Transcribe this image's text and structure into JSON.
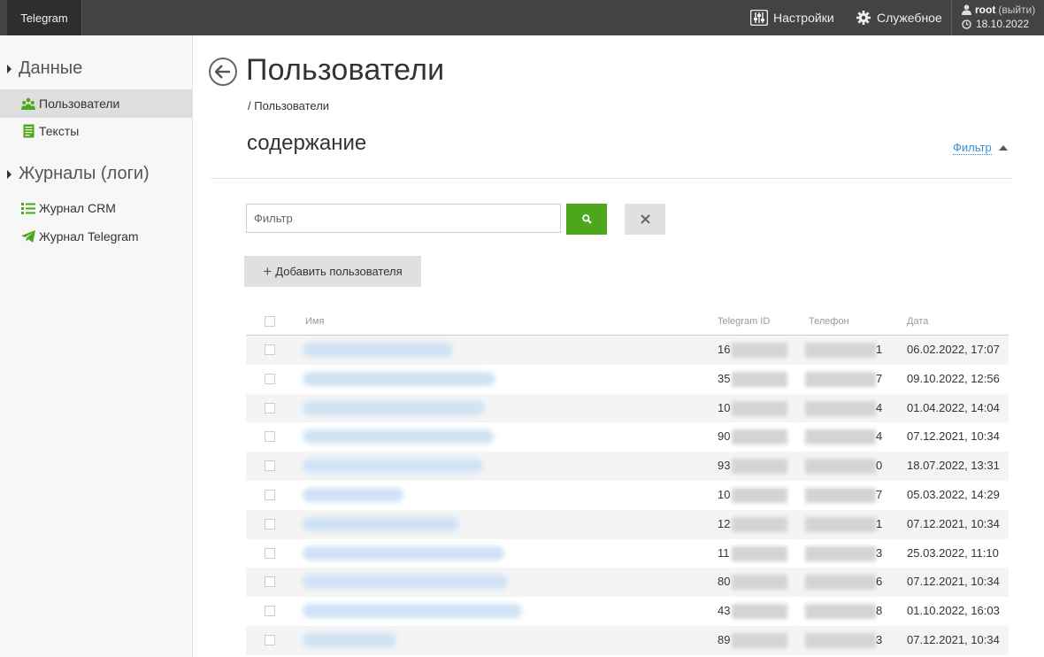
{
  "app": {
    "brand": "Telegram"
  },
  "topnav": {
    "settings": "Настройки",
    "service": "Служебное",
    "user": "root",
    "logout": "(выйти)",
    "date": "18.10.2022"
  },
  "sidebar": {
    "sections": [
      {
        "title": "Данные"
      },
      {
        "title": "Журналы (логи)"
      }
    ],
    "items": [
      {
        "label": "Пользователи",
        "icon": "users-icon",
        "active": true
      },
      {
        "label": "Тексты",
        "icon": "document-icon"
      },
      {
        "label": "Журнал CRM",
        "icon": "list-icon"
      },
      {
        "label": "Журнал Telegram",
        "icon": "telegram-icon"
      }
    ]
  },
  "page": {
    "title": "Пользователи",
    "breadcrumb": "/ Пользователи",
    "section": "содержание",
    "filter_toggle": "Фильтр"
  },
  "filter": {
    "placeholder": "Фильтр"
  },
  "actions": {
    "add_user": "Добавить пользователя"
  },
  "table": {
    "columns": {
      "name": "Имя",
      "telegram_id": "Telegram ID",
      "phone": "Телефон",
      "date": "Дата"
    },
    "rows": [
      {
        "tid": "16",
        "phone": "1",
        "date": "06.02.2022, 17:07"
      },
      {
        "tid": "35",
        "phone": "7",
        "date": "09.10.2022, 12:56"
      },
      {
        "tid": "10",
        "phone": "4",
        "date": "01.04.2022, 14:04"
      },
      {
        "tid": "90",
        "phone": "4",
        "date": "07.12.2021, 10:34"
      },
      {
        "tid": "93",
        "phone": "0",
        "date": "18.07.2022, 13:31"
      },
      {
        "tid": "10",
        "phone": "7",
        "date": "05.03.2022, 14:29"
      },
      {
        "tid": "12",
        "phone": "1",
        "date": "07.12.2021, 10:34"
      },
      {
        "tid": "11",
        "phone": "3",
        "date": "25.03.2022, 11:10"
      },
      {
        "tid": "80",
        "phone": "6",
        "date": "07.12.2021, 10:34"
      },
      {
        "tid": "43",
        "phone": "8",
        "date": "01.10.2022, 16:03"
      },
      {
        "tid": "89",
        "phone": "3",
        "date": "07.12.2021, 10:34"
      }
    ]
  },
  "colors": {
    "accent": "#4ca71a",
    "link": "#3a8bd3",
    "topbar": "#434343"
  }
}
